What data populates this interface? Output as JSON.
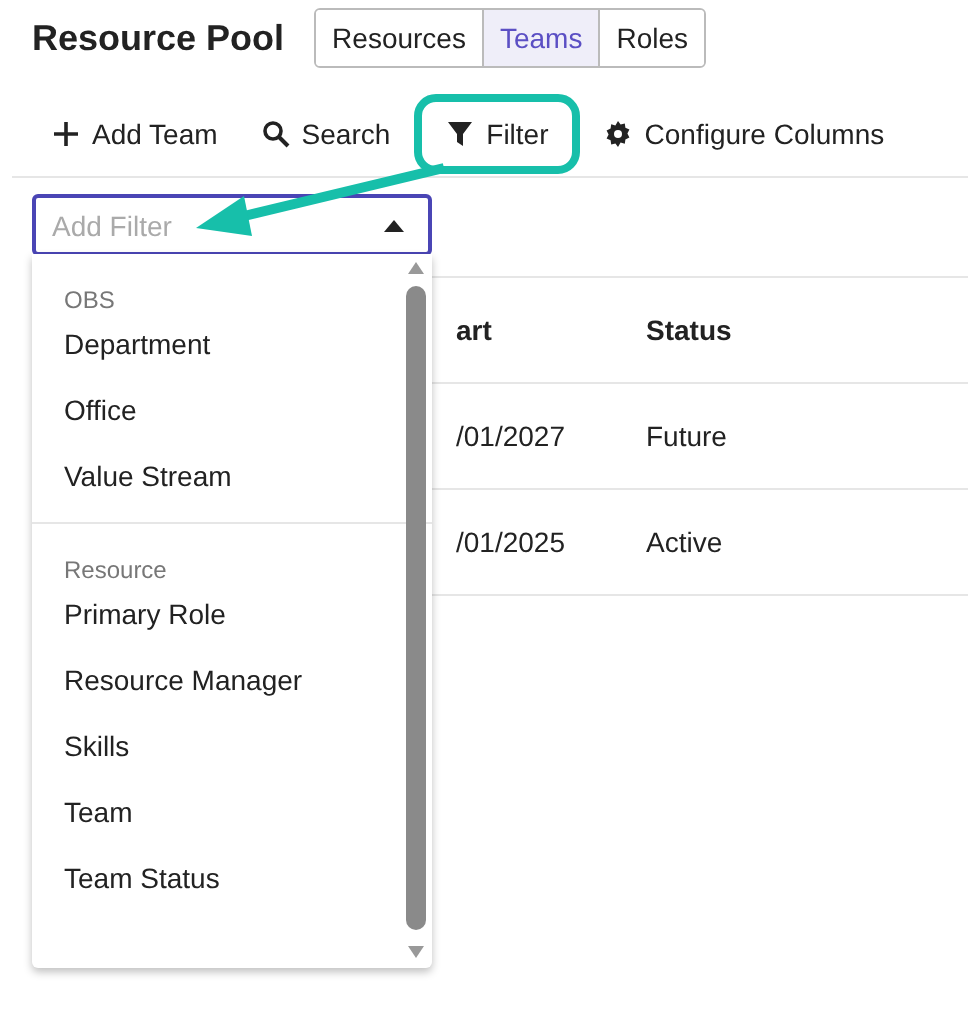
{
  "page_title": "Resource Pool",
  "tabs": [
    {
      "label": "Resources",
      "selected": false
    },
    {
      "label": "Teams",
      "selected": true
    },
    {
      "label": "Roles",
      "selected": false
    }
  ],
  "toolbar": [
    {
      "label": "Add Team",
      "kind": "add",
      "highlighted": false
    },
    {
      "label": "Search",
      "kind": "search",
      "highlighted": false
    },
    {
      "label": "Filter",
      "kind": "filter",
      "highlighted": true
    },
    {
      "label": "Configure Columns",
      "kind": "gear",
      "highlighted": false
    }
  ],
  "filter_field": {
    "placeholder": "Add Filter",
    "expanded": true
  },
  "table": {
    "columns": [
      "art",
      "Status"
    ],
    "rows": [
      [
        "/01/2027",
        "Future"
      ],
      [
        "/01/2025",
        "Active"
      ]
    ]
  },
  "dropdown": [
    {
      "group": "OBS",
      "items": [
        "Department",
        "Office",
        "Value Stream"
      ]
    },
    {
      "group": "Resource",
      "items": [
        "Primary Role",
        "Resource Manager",
        "Skills",
        "Team",
        "Team Status"
      ]
    }
  ]
}
